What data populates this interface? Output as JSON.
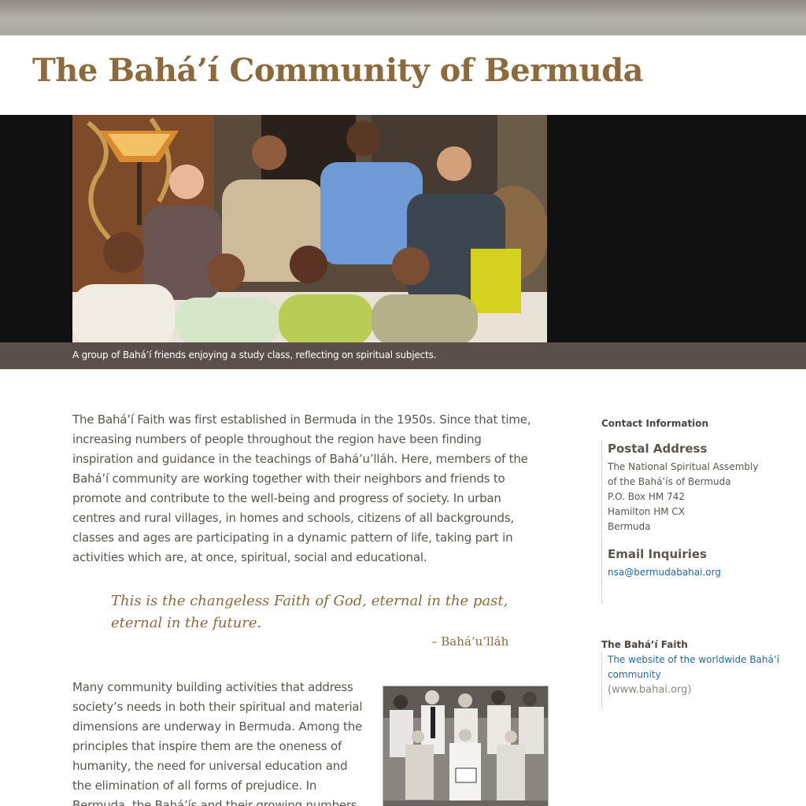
{
  "header": {
    "title": "The Bahá’í Community of Bermuda"
  },
  "hero": {
    "caption": "A group of Bahá’í friends enjoying a study class, reflecting on spiritual subjects."
  },
  "main": {
    "intro_paragraph": "The Bahá’í Faith was first established in Bermuda in the 1950s. Since that time, increasing numbers of people throughout the region have been finding inspiration and guidance in the teachings of Bahá’u’lláh. Here, members of the Bahá’í community are working together with their neighbors and friends to promote and contribute to the well-being and progress of society. In urban centres and rural villages, in homes and schools, citizens of all backgrounds, classes and ages are participating in a dynamic pattern of life, taking part in activities which are, at once, spiritual, social and educational.",
    "quote": "This is the changeless Faith of God, eternal in the past, eternal in the future.",
    "quote_attribution": "– Bahá’u’lláh",
    "second_paragraph": "Many community building activities that address society’s needs in both their spiritual and material dimensions are underway in Bermuda. Among the principles that inspire them are the oneness of humanity, the need for universal education and the elimination of all forms of prejudice. In Bermuda, the Bahá’ís and their growing numbers of friends"
  },
  "sidebar": {
    "contact_heading": "Contact Information",
    "postal_heading": "Postal Address",
    "postal_lines": [
      "The National Spiritual Assembly",
      "of the Bahá’ís of Bermuda",
      "P.O. Box HM 742",
      "Hamilton HM CX",
      "Bermuda"
    ],
    "email_heading": "Email Inquiries",
    "email": "nsa@bermudabahai.org",
    "faith_heading": "The Bahá’í Faith",
    "faith_link_line1": "The website of the worldwide Bahá’í",
    "faith_link_line2": "community",
    "faith_url": "(www.bahai.org)"
  },
  "colors": {
    "title": "#8c6a3c",
    "link": "#1f6aa5",
    "caption_band": "#5b4f4a",
    "hero_band": "#111111"
  }
}
